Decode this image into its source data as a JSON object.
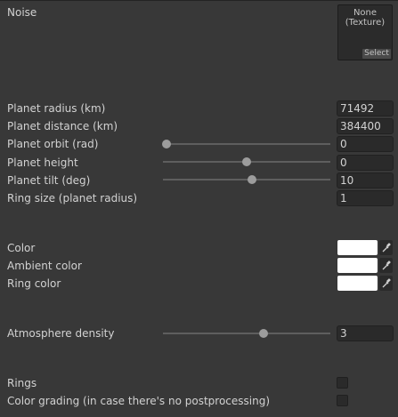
{
  "noise": {
    "label": "Noise",
    "texture_name": "None",
    "texture_type": "(Texture)",
    "select_label": "Select"
  },
  "planet": {
    "radius_label": "Planet radius (km)",
    "radius_value": "71492",
    "distance_label": "Planet distance (km)",
    "distance_value": "384400",
    "orbit_label": "Planet orbit (rad)",
    "orbit_value": "0",
    "orbit_slider_fraction": 0.02,
    "height_label": "Planet height",
    "height_value": "0",
    "height_slider_fraction": 0.5,
    "tilt_label": "Planet tilt (deg)",
    "tilt_value": "10",
    "tilt_slider_fraction": 0.53,
    "ring_size_label": "Ring size (planet radius)",
    "ring_size_value": "1"
  },
  "colors": {
    "color_label": "Color",
    "color_value": "#ffffff",
    "ambient_label": "Ambient color",
    "ambient_value": "#ffffff",
    "ring_label": "Ring color",
    "ring_value": "#ffffff",
    "picker_icon": "eyedropper-icon"
  },
  "atmosphere": {
    "density_label": "Atmosphere density",
    "density_value": "3",
    "density_slider_fraction": 0.6
  },
  "toggles": {
    "rings_label": "Rings",
    "rings_checked": false,
    "grading_label": "Color grading (in case there's no postprocessing)",
    "grading_checked": false
  }
}
